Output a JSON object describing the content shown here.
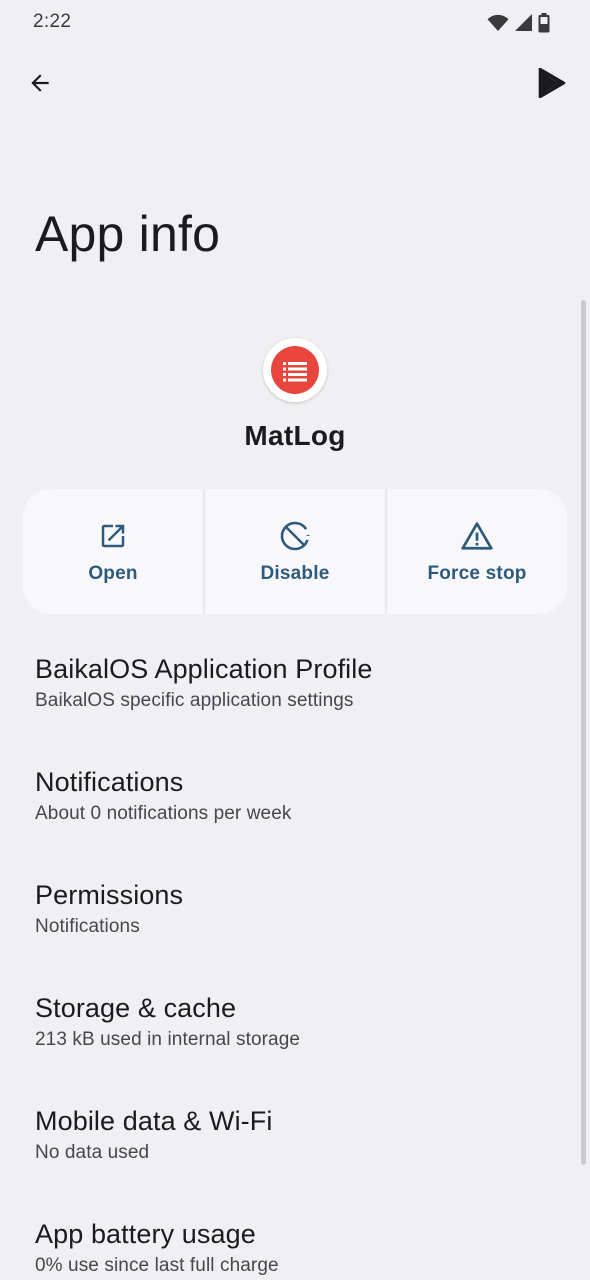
{
  "status_bar": {
    "time": "2:22",
    "icons": [
      "wifi-icon",
      "signal-icon",
      "battery-icon"
    ]
  },
  "top_bar": {
    "back_icon": "arrow-back-icon",
    "store_icon": "play-store-icon"
  },
  "page_title": "App info",
  "app": {
    "name": "MatLog",
    "icon": "matlog-app-icon",
    "icon_color": "#e8463c"
  },
  "actions": [
    {
      "label": "Open",
      "icon": "open-external-icon"
    },
    {
      "label": "Disable",
      "icon": "disable-icon"
    },
    {
      "label": "Force stop",
      "icon": "warning-triangle-icon"
    }
  ],
  "colors": {
    "background": "#f0f0f3",
    "card": "#f8f8fb",
    "accent": "#2e5b7c"
  },
  "preferences": [
    {
      "title": "BaikalOS Application Profile",
      "summary": "BaikalOS specific application settings"
    },
    {
      "title": "Notifications",
      "summary": "About 0 notifications per week"
    },
    {
      "title": "Permissions",
      "summary": "Notifications"
    },
    {
      "title": "Storage & cache",
      "summary": "213 kB used in internal storage"
    },
    {
      "title": "Mobile data & Wi-Fi",
      "summary": "No data used"
    },
    {
      "title": "App battery usage",
      "summary": "0% use since last full charge"
    }
  ]
}
